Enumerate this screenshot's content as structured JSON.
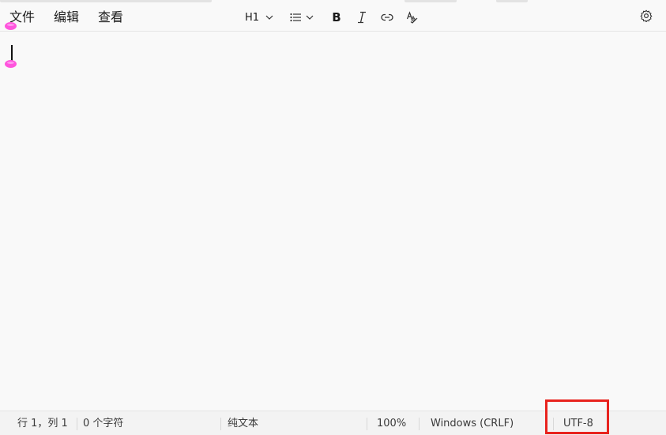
{
  "menu": {
    "file": "文件",
    "edit": "编辑",
    "view": "查看"
  },
  "format_toolbar": {
    "heading_label": "H1",
    "bold_label": "B",
    "icons": [
      "chevron-down-icon",
      "bulleted-list-icon",
      "italic-icon",
      "link-icon",
      "spellcheck-icon",
      "gear-icon"
    ]
  },
  "editor": {
    "content": ""
  },
  "status": {
    "position": "行 1，列 1",
    "char_count": "0 个字符",
    "format": "纯文本",
    "zoom": "100%",
    "line_ending": "Windows (CRLF)",
    "encoding": "UTF-8"
  },
  "colors": {
    "selection_handle": "#ff55dd",
    "highlight_box": "#e8231e"
  }
}
